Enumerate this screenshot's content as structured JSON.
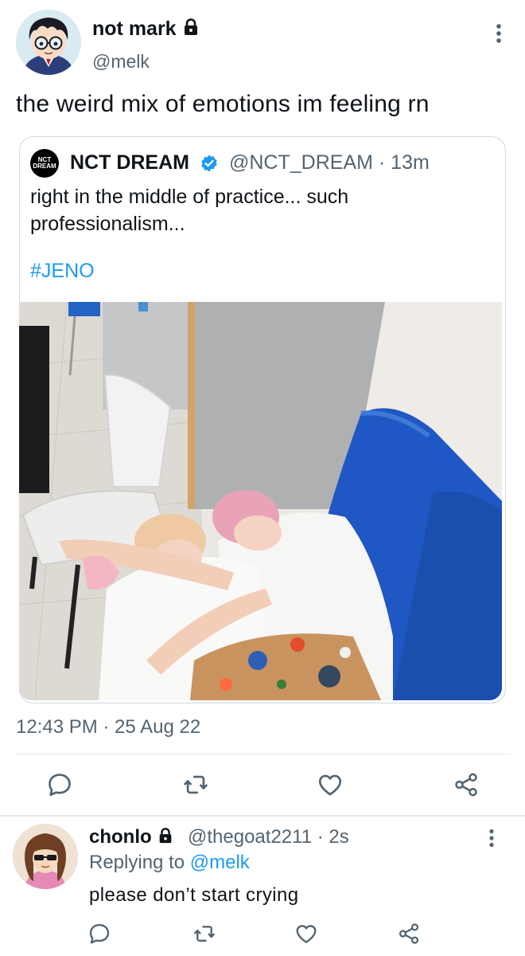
{
  "main_tweet": {
    "author": {
      "display_name": "not mark",
      "handle": "@melk",
      "protected": true,
      "avatar": "anime-boy-glasses-avatar"
    },
    "text": "the weird mix of emotions im feeling rn",
    "timestamp": "12:43 PM · 25 Aug 22",
    "more_icon": "more-vertical-icon"
  },
  "quoted_tweet": {
    "author": {
      "display_name": "NCT DREAM",
      "avatar_text": "NCT DREAM",
      "verified": true,
      "handle": "@NCT_DREAM",
      "time_ago": "13m"
    },
    "meta": "@NCT_DREAM · 13m",
    "text": "right in the middle of practice... such professionalism...",
    "hashtag": "#JENO",
    "photo": "two-people-napping-on-blue-bench"
  },
  "actions": {
    "reply": "reply-icon",
    "retweet": "retweet-icon",
    "like": "like-icon",
    "share": "share-icon"
  },
  "reply": {
    "author": {
      "display_name": "chonlo",
      "handle": "@thegoat2211",
      "time_ago": "2s",
      "protected": true,
      "avatar": "cartoon-girl-sunglasses-avatar"
    },
    "meta": "@thegoat2211 · 2s",
    "replying_to_label": "Replying to",
    "replying_to_handle": "@melk",
    "text": "please don’t start crying",
    "more_icon": "more-vertical-icon"
  },
  "colors": {
    "text": "#0f1419",
    "secondary": "#536471",
    "link": "#1d9bf0",
    "border": "#cfd9de",
    "verified": "#1d9bf0",
    "bench": "#1f58c4"
  }
}
